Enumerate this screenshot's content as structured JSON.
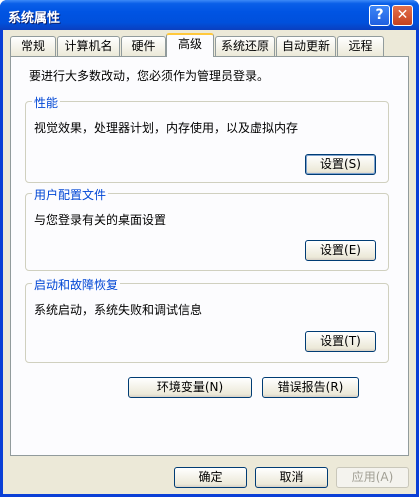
{
  "window": {
    "title": "系统属性",
    "help_glyph": "?",
    "close_glyph": "✕"
  },
  "tabs": [
    {
      "label": "常规"
    },
    {
      "label": "计算机名"
    },
    {
      "label": "硬件"
    },
    {
      "label": "高级",
      "active": true
    },
    {
      "label": "系统还原"
    },
    {
      "label": "自动更新"
    },
    {
      "label": "远程"
    }
  ],
  "admin_note": "要进行大多数改动，您必须作为管理员登录。",
  "performance": {
    "title": "性能",
    "description": "视觉效果，处理器计划，内存使用，以及虚拟内存",
    "button": "设置(S)"
  },
  "user_profiles": {
    "title": "用户配置文件",
    "description": "与您登录有关的桌面设置",
    "button": "设置(E)"
  },
  "startup_recovery": {
    "title": "启动和故障恢复",
    "description": "系统启动，系统失败和调试信息",
    "button": "设置(T)"
  },
  "env_vars_button": "环境变量(N)",
  "error_report_button": "错误报告(R)",
  "footer": {
    "ok": "确定",
    "cancel": "取消",
    "apply": "应用(A)"
  }
}
